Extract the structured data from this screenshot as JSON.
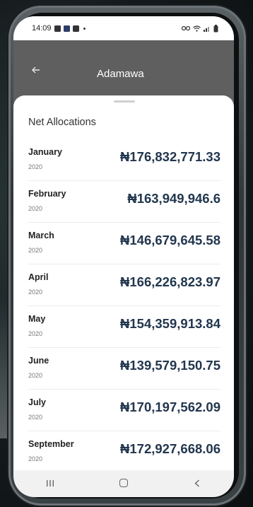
{
  "status_bar": {
    "time": "14:09",
    "icons": [
      "image-icon",
      "t-icon",
      "app-icon",
      "dot"
    ],
    "right_icons": [
      "link-icon",
      "wifi-icon",
      "signal-icon",
      "battery-icon"
    ]
  },
  "app_bar": {
    "title": "Adamawa",
    "back_icon": "arrow-left-icon"
  },
  "sheet": {
    "title": "Net Allocations",
    "rows": [
      {
        "month": "January",
        "year": "2020",
        "amount": "₦176,832,771.33"
      },
      {
        "month": "February",
        "year": "2020",
        "amount": "₦163,949,946.6"
      },
      {
        "month": "March",
        "year": "2020",
        "amount": "₦146,679,645.58"
      },
      {
        "month": "April",
        "year": "2020",
        "amount": "₦166,226,823.97"
      },
      {
        "month": "May",
        "year": "2020",
        "amount": "₦154,359,913.84"
      },
      {
        "month": "June",
        "year": "2020",
        "amount": "₦139,579,150.75"
      },
      {
        "month": "July",
        "year": "2020",
        "amount": "₦170,197,562.09"
      },
      {
        "month": "September",
        "year": "2020",
        "amount": "₦172,927,668.06"
      }
    ]
  },
  "nav_bar": {
    "items": [
      "recents-icon",
      "home-icon",
      "back-icon"
    ]
  },
  "colors": {
    "amount": "#22364e",
    "app_bar": "#5f5f5f",
    "sheet": "#ffffff"
  }
}
